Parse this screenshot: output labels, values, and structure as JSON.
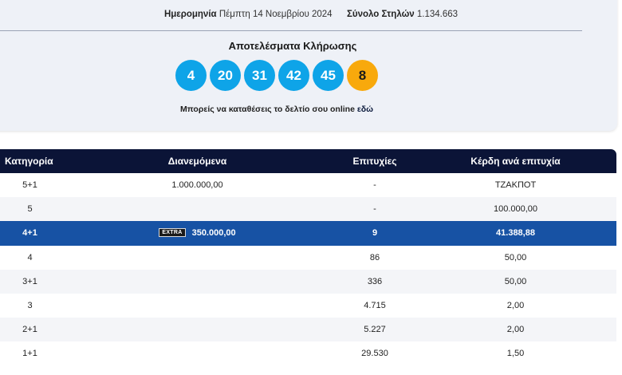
{
  "header": {
    "date_label": "Ημερομηνία",
    "date_value": "Πέμπτη 14 Νοεμβρίου 2024",
    "columns_label": "Σύνολο Στηλών",
    "columns_value": "1.134.663"
  },
  "results": {
    "title": "Αποτελέσματα Κλήρωσης",
    "numbers": [
      "4",
      "20",
      "31",
      "42",
      "45"
    ],
    "joker": "8",
    "online_text": "Μπορείς να καταθέσεις το δελτίο σου online",
    "online_link": "εδώ"
  },
  "colors": {
    "ball": "#0ea4e8",
    "joker": "#f8a90c",
    "header_bg": "#0b1437",
    "highlight": "#1752a4"
  },
  "table": {
    "headers": [
      "Κατηγορία",
      "Διανεμόμενα",
      "Επιτυχίες",
      "Κέρδη ανά επιτυχία"
    ],
    "extra_badge": "EXTRA",
    "rows": [
      {
        "category": "5+1",
        "distributed": "1.000.000,00",
        "wins": "-",
        "prize": "ΤΖΑΚΠΟΤ"
      },
      {
        "category": "5",
        "distributed": "",
        "wins": "-",
        "prize": "100.000,00"
      },
      {
        "category": "4+1",
        "distributed": "350.000,00",
        "wins": "9",
        "prize": "41.388,88"
      },
      {
        "category": "4",
        "distributed": "",
        "wins": "86",
        "prize": "50,00"
      },
      {
        "category": "3+1",
        "distributed": "",
        "wins": "336",
        "prize": "50,00"
      },
      {
        "category": "3",
        "distributed": "",
        "wins": "4.715",
        "prize": "2,00"
      },
      {
        "category": "2+1",
        "distributed": "",
        "wins": "5.227",
        "prize": "2,00"
      },
      {
        "category": "1+1",
        "distributed": "",
        "wins": "29.530",
        "prize": "1,50"
      }
    ]
  }
}
